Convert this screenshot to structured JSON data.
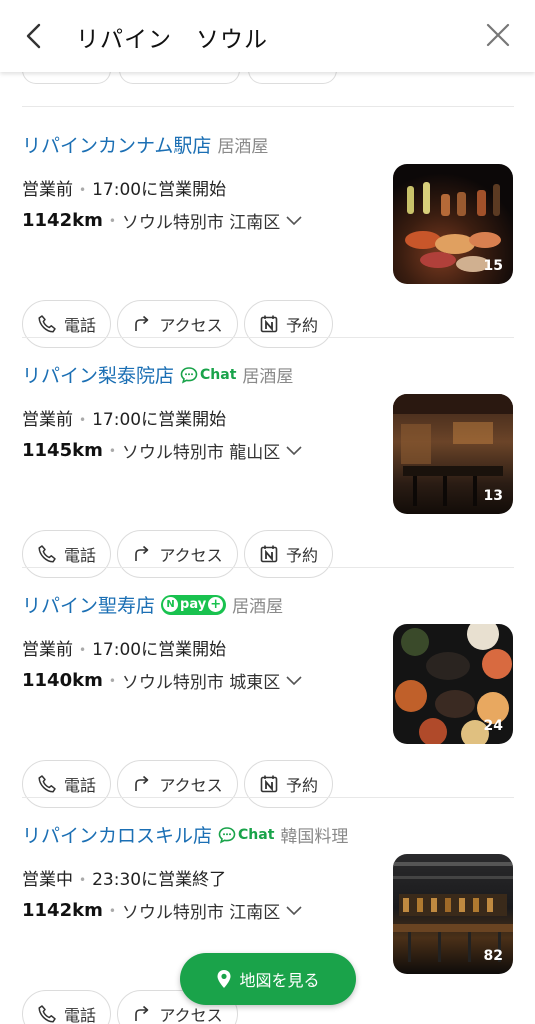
{
  "header": {
    "query": "リパイン　ソウル",
    "back_icon": "chevron-left-icon",
    "close_icon": "close-icon"
  },
  "labels": {
    "chat": "Chat",
    "call": "電話",
    "access": "アクセス",
    "reserve": "予約",
    "npay": "pay"
  },
  "places": [
    {
      "name": "リパイン カンナム駅店",
      "display_name": "リパインカンナム駅店",
      "category": "居酒屋",
      "badge": "",
      "status": "営業前",
      "hours": "17:00に営業開始",
      "distance": "1142km",
      "address": "ソウル特別市 江南区",
      "photo_count": "15",
      "actions": [
        "call",
        "access",
        "reserve"
      ]
    },
    {
      "display_name": "リパイン梨泰院店",
      "category": "居酒屋",
      "badge": "chat",
      "status": "営業前",
      "hours": "17:00に営業開始",
      "distance": "1145km",
      "address": "ソウル特別市 龍山区",
      "photo_count": "13",
      "actions": [
        "call",
        "access",
        "reserve"
      ]
    },
    {
      "display_name": "リパイン聖寿店",
      "category": "居酒屋",
      "badge": "npay",
      "status": "営業前",
      "hours": "17:00に営業開始",
      "distance": "1140km",
      "address": "ソウル特別市 城東区",
      "photo_count": "24",
      "actions": [
        "call",
        "access",
        "reserve"
      ]
    },
    {
      "display_name": "リパインカロスキル店",
      "category": "韓国料理",
      "badge": "chat",
      "status": "営業中",
      "hours": "23:30に営業終了",
      "distance": "1142km",
      "address": "ソウル特別市 江南区",
      "photo_count": "82",
      "actions": [
        "call",
        "access"
      ]
    }
  ],
  "map_button": {
    "label": "地図を見る",
    "icon": "map-pin-icon"
  },
  "colors": {
    "link": "#1b6fb4",
    "accent_green": "#1aa34a",
    "npay_green": "#19c24f"
  }
}
